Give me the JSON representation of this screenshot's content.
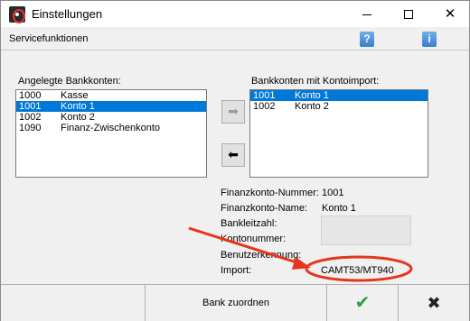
{
  "window": {
    "title": "Einstellungen",
    "minimize_glyph": "",
    "maximize_glyph": "",
    "close_glyph": "✕"
  },
  "toolbar": {
    "menu_label": "Servicefunktionen",
    "help_icon": "?",
    "info_icon": "i"
  },
  "left_list": {
    "label": "Angelegte Bankkonten:",
    "items": [
      {
        "num": "1000",
        "name": "Kasse",
        "selected": false
      },
      {
        "num": "1001",
        "name": "Konto 1",
        "selected": true
      },
      {
        "num": "1002",
        "name": "Konto 2",
        "selected": false
      },
      {
        "num": "1090",
        "name": "Finanz-Zwischenkonto",
        "selected": false
      }
    ]
  },
  "right_list": {
    "label": "Bankkonten mit Kontoimport:",
    "items": [
      {
        "num": "1001",
        "name": "Konto 1",
        "selected": true
      },
      {
        "num": "1002",
        "name": "Konto 2",
        "selected": false
      }
    ]
  },
  "transfer": {
    "to_right_glyph": "➡",
    "to_left_glyph": "⬅"
  },
  "details": {
    "finanzkonto_nummer_label": "Finanzkonto-Nummer:",
    "finanzkonto_nummer_value": "1001",
    "finanzkonto_name_label": "Finanzkonto-Name:",
    "finanzkonto_name_value": "Konto 1",
    "bankleitzahl_label": "Bankleitzahl:",
    "kontonummer_label": "Kontonummer:",
    "benutzerkennung_label": "Benutzerkennung:",
    "import_label": "Import:",
    "import_value": "CAMT53/MT940"
  },
  "footer": {
    "assign_label": "Bank zuordnen",
    "ok_glyph": "✔",
    "cancel_glyph": "✖"
  },
  "colors": {
    "selection": "#0078d7",
    "annotation": "#e8341c",
    "ok": "#2e9e47"
  }
}
